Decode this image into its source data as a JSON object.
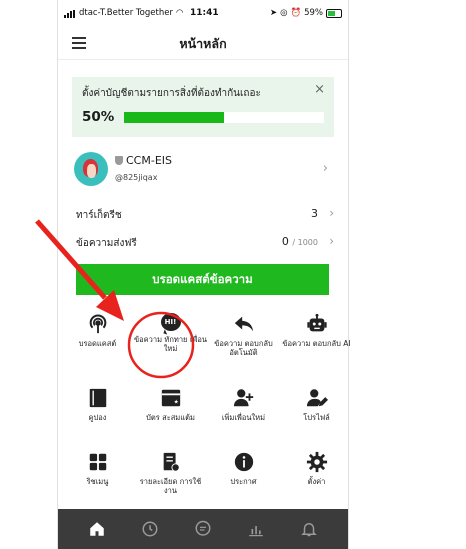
{
  "status_bar": {
    "carrier": "dtac-T.Better Together",
    "time": "11:41",
    "battery": "59%"
  },
  "header": {
    "title": "หน้าหลัก",
    "menu_icon": "hamburger-icon"
  },
  "setup_card": {
    "text": "ตั้งค่าบัญชีตามรายการสิ่งที่ต้องทำกันเถอะ",
    "percent_label": "50%",
    "progress": 0.5,
    "close_label": "×"
  },
  "profile": {
    "name": "CCM-EIS",
    "id": "@825jiqax"
  },
  "rows": [
    {
      "label": "ทาร์เก็ตรีช",
      "value": "3",
      "suffix": ""
    },
    {
      "label": "ข้อความส่งฟรี",
      "value": "0",
      "suffix": "/ 1000"
    }
  ],
  "broadcast_button": "บรอดแคสต์ข้อความ",
  "features": [
    {
      "label": "บรอดแคสต์",
      "icon": "broadcast-icon"
    },
    {
      "label": "ข้อความ ทักทาย เพื่อนใหม่",
      "icon": "greeting-bubble-icon",
      "icon_text": "HI!"
    },
    {
      "label": "ข้อความ ตอบกลับ อัตโนมัติ",
      "icon": "reply-arrow-icon"
    },
    {
      "label": "ข้อความ ตอบกลับ AI",
      "icon": "robot-icon"
    },
    {
      "label": "คูปอง",
      "icon": "coupon-icon"
    },
    {
      "label": "บัตร สะสมแต้ม",
      "icon": "reward-card-icon"
    },
    {
      "label": "เพิ่มเพื่อนใหม่",
      "icon": "add-friend-icon"
    },
    {
      "label": "โปรไฟล์",
      "icon": "profile-edit-icon"
    },
    {
      "label": "ริชเมนู",
      "icon": "rich-menu-icon"
    },
    {
      "label": "รายละเอียด การใช้งาน",
      "icon": "usage-details-icon"
    },
    {
      "label": "ประกาศ",
      "icon": "info-icon"
    },
    {
      "label": "ตั้งค่า",
      "icon": "settings-gear-icon"
    }
  ],
  "tabbar": [
    "home-icon",
    "clock-icon",
    "chat-icon",
    "stats-icon",
    "bell-icon"
  ],
  "colors": {
    "accent_green": "#1fb81f",
    "annotation_red": "#e8221c",
    "tabbar": "#3b3b3b"
  }
}
